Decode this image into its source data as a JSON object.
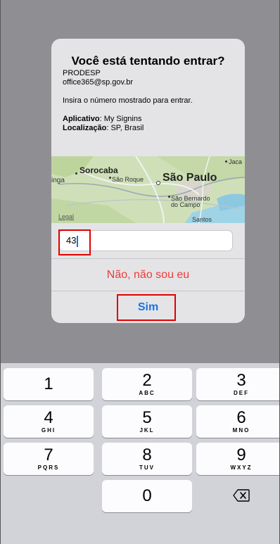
{
  "dialog": {
    "title": "Você está tentando entrar?",
    "org": "PRODESP",
    "account": "office365@sp.gov.br",
    "instruction": "Insira o número mostrado para entrar.",
    "app_label": "Aplicativo",
    "app_value": ": My Signins",
    "location_label": "Localização",
    "location_value": ": SP, Brasil",
    "map": {
      "labels": {
        "sorocaba": "Sorocaba",
        "sao_roque": "São Roque",
        "sao_paulo": "São Paulo",
        "inga": "inga",
        "jaca": "Jaca",
        "sao_bernardo": "São Bernardo",
        "do_campo": "do Campo",
        "santos": "Santos"
      },
      "legal": "Legal"
    },
    "input_value": "43",
    "deny_label": "Não, não sou eu",
    "approve_label": "Sim"
  },
  "keyboard": {
    "keys": [
      {
        "num": "1",
        "letters": ""
      },
      {
        "num": "2",
        "letters": "ABC"
      },
      {
        "num": "3",
        "letters": "DEF"
      },
      {
        "num": "4",
        "letters": "GHI"
      },
      {
        "num": "5",
        "letters": "JKL"
      },
      {
        "num": "6",
        "letters": "MNO"
      },
      {
        "num": "7",
        "letters": "PQRS"
      },
      {
        "num": "8",
        "letters": "TUV"
      },
      {
        "num": "9",
        "letters": "WXYZ"
      },
      {
        "num": "0",
        "letters": ""
      }
    ],
    "delete_icon": "backspace-icon"
  },
  "colors": {
    "deny": "#ef3b3b",
    "approve": "#1a73e8",
    "highlight": "#e00000"
  }
}
